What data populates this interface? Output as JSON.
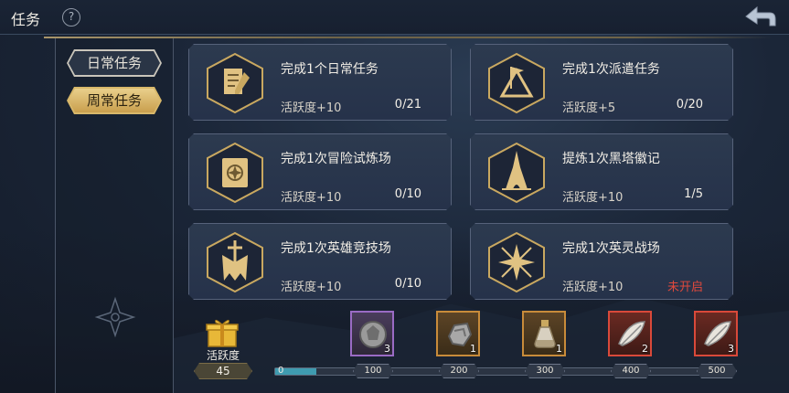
{
  "header": {
    "title": "任务",
    "help_icon": "question-gear-icon",
    "back_icon": "return-arrow-icon"
  },
  "tabs": [
    {
      "label": "日常任务",
      "active": false
    },
    {
      "label": "周常任务",
      "active": true
    }
  ],
  "quests": [
    {
      "title": "完成1个日常任务",
      "reward": "活跃度+10",
      "progress": "0/21",
      "icon": "document-quill-icon"
    },
    {
      "title": "完成1次派遣任务",
      "reward": "活跃度+5",
      "progress": "0/20",
      "icon": "flag-tent-icon"
    },
    {
      "title": "完成1次冒险试炼场",
      "reward": "活跃度+10",
      "progress": "0/10",
      "icon": "spellbook-icon"
    },
    {
      "title": "提炼1次黑塔徽记",
      "reward": "活跃度+10",
      "progress": "1/5",
      "icon": "black-tower-icon"
    },
    {
      "title": "完成1次英雄竞技场",
      "reward": "活跃度+10",
      "progress": "0/10",
      "icon": "sword-cape-icon"
    },
    {
      "title": "完成1次英灵战场",
      "reward": "活跃度+10",
      "progress": "未开启",
      "icon": "crossed-swords-star-icon",
      "locked": true
    }
  ],
  "activity": {
    "label": "活跃度",
    "value": "45",
    "icon": "gift-box-icon"
  },
  "progress_bar": {
    "value": 45,
    "max": 500,
    "start_label": "0"
  },
  "milestones": [
    {
      "label": "100",
      "reward_count": "3",
      "reward_icon": "grey-crest-stone-icon",
      "frame_color": "#9a6bc4"
    },
    {
      "label": "200",
      "reward_count": "1",
      "reward_icon": "grey-ore-icon",
      "frame_color": "#c88b3a"
    },
    {
      "label": "300",
      "reward_count": "1",
      "reward_icon": "potion-flask-icon",
      "frame_color": "#c88b3a"
    },
    {
      "label": "400",
      "reward_count": "2",
      "reward_icon": "white-feather-icon",
      "frame_color": "#d9493a"
    },
    {
      "label": "500",
      "reward_count": "3",
      "reward_icon": "white-feather-icon",
      "frame_color": "#d9493a"
    }
  ]
}
